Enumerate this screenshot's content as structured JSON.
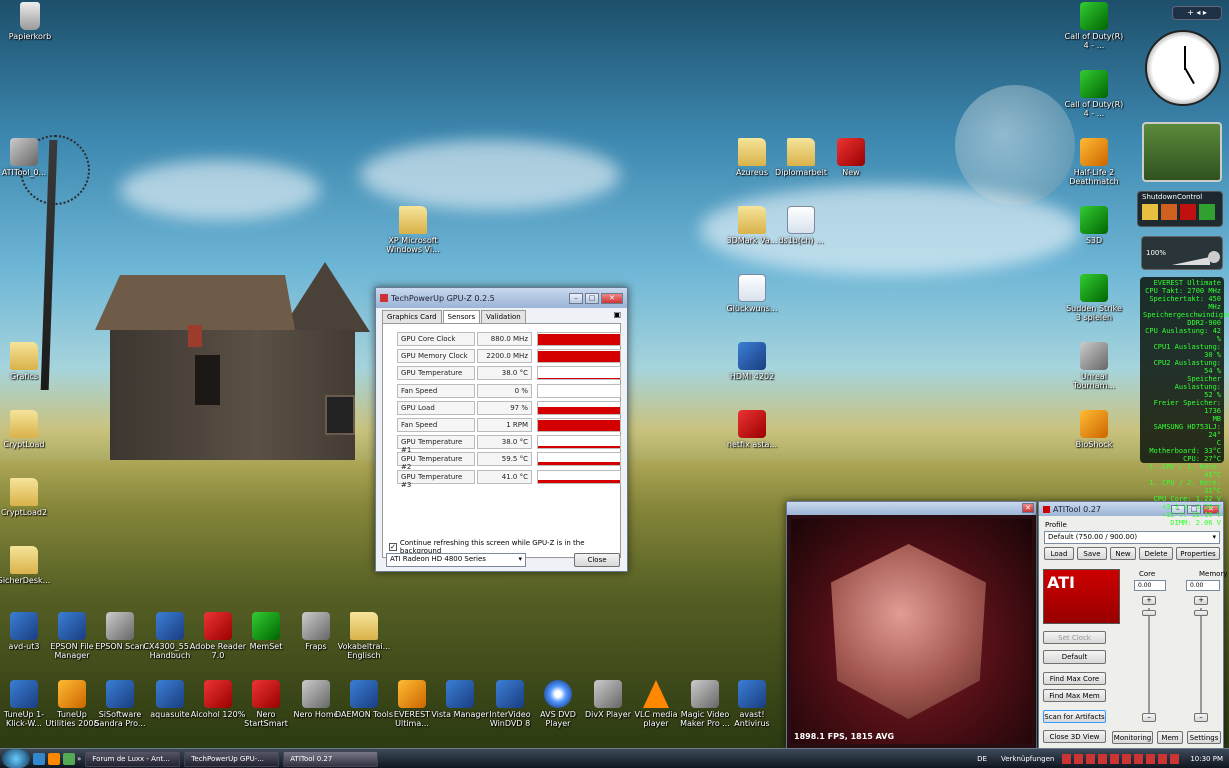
{
  "desktop_icons": [
    {
      "id": "papierkorb",
      "label": "Papierkorb",
      "kind": "bin"
    },
    {
      "id": "atitool",
      "label": "ATITool_0...",
      "kind": "gray"
    },
    {
      "id": "grafics",
      "label": "Grafics",
      "kind": "folder"
    },
    {
      "id": "cryptload",
      "label": "CryptLoad",
      "kind": "folder"
    },
    {
      "id": "cryptload2",
      "label": "CryptLoad2",
      "kind": "folder"
    },
    {
      "id": "sicherdesk",
      "label": "SicherDesk...",
      "kind": "folder"
    },
    {
      "id": "xp_theme",
      "label": "XP Microsoft Windows Vi...",
      "kind": "folder"
    },
    {
      "id": "azureus",
      "label": "Azureus",
      "kind": "folder"
    },
    {
      "id": "diplomarbeit",
      "label": "Diplomarbeit",
      "kind": "folder"
    },
    {
      "id": "new",
      "label": "New",
      "kind": "red"
    },
    {
      "id": "3dmark",
      "label": "3DMark Va...",
      "kind": "folder"
    },
    {
      "id": "ds1b",
      "label": "ds1b(ch) ...",
      "kind": "doc"
    },
    {
      "id": "glueckwunsch",
      "label": "Glückwuns...",
      "kind": "doc"
    },
    {
      "id": "hdmi",
      "label": "HDMI 4202",
      "kind": "exe"
    },
    {
      "id": "netfix",
      "label": "netfix asta...",
      "kind": "red"
    },
    {
      "id": "cod1",
      "label": "Call of Duty(R) 4 - ...",
      "kind": "green"
    },
    {
      "id": "cod2",
      "label": "Call of Duty(R) 4 - ...",
      "kind": "green"
    },
    {
      "id": "halflife",
      "label": "Half-Life 2 Deathmatch",
      "kind": "orange"
    },
    {
      "id": "s3d",
      "label": "S3D",
      "kind": "green"
    },
    {
      "id": "sudden",
      "label": "Sudden Strike 3 spielen",
      "kind": "green"
    },
    {
      "id": "unreal",
      "label": "Unreal Tournam...",
      "kind": "gray"
    },
    {
      "id": "bioshock",
      "label": "BioShock",
      "kind": "orange"
    }
  ],
  "bottom_icons_row1": [
    {
      "id": "avd",
      "label": "avd-ut3",
      "kind": "exe"
    },
    {
      "id": "epson_fm",
      "label": "EPSON File Manager",
      "kind": "exe"
    },
    {
      "id": "epson_scan",
      "label": "EPSON Scan",
      "kind": "gray"
    },
    {
      "id": "cx4300",
      "label": "CX4300_55... Handbuch",
      "kind": "exe"
    },
    {
      "id": "adobe",
      "label": "Adobe Reader 7.0",
      "kind": "red"
    },
    {
      "id": "memset",
      "label": "MemSet",
      "kind": "green"
    },
    {
      "id": "fraps",
      "label": "Fraps",
      "kind": "gray"
    },
    {
      "id": "vokabel",
      "label": "Vokabeltrai... Englisch",
      "kind": "folder"
    }
  ],
  "bottom_icons_row2": [
    {
      "id": "tuneup1",
      "label": "TuneUp 1-Klick-W...",
      "kind": "exe"
    },
    {
      "id": "tuneup2",
      "label": "TuneUp Utilities 2008",
      "kind": "orange"
    },
    {
      "id": "sisoft",
      "label": "SiSoftware Sandra Pro...",
      "kind": "exe"
    },
    {
      "id": "aquasuite",
      "label": "aquasuite",
      "kind": "exe"
    },
    {
      "id": "alcohol",
      "label": "Alcohol 120%",
      "kind": "red"
    },
    {
      "id": "nero_ss",
      "label": "Nero StartSmart",
      "kind": "red"
    },
    {
      "id": "nero_home",
      "label": "Nero Home",
      "kind": "gray"
    },
    {
      "id": "daemon",
      "label": "DAEMON Tools",
      "kind": "exe"
    },
    {
      "id": "everest",
      "label": "EVEREST Ultima...",
      "kind": "orange"
    },
    {
      "id": "vista_mgr",
      "label": "Vista Manager",
      "kind": "exe"
    },
    {
      "id": "intervideo",
      "label": "InterVideo WinDVD 8",
      "kind": "exe"
    },
    {
      "id": "avsdvd",
      "label": "AVS DVD Player",
      "kind": "disc"
    },
    {
      "id": "divx",
      "label": "DivX Player",
      "kind": "gray"
    },
    {
      "id": "vlc",
      "label": "VLC media player",
      "kind": "cone"
    },
    {
      "id": "magicvideo",
      "label": "Magic Video Maker Pro ...",
      "kind": "gray"
    },
    {
      "id": "avast",
      "label": "avast! Antivirus",
      "kind": "exe"
    }
  ],
  "gpuz": {
    "title": "TechPowerUp GPU-Z 0.2.5",
    "tabs": [
      "Graphics Card",
      "Sensors",
      "Validation"
    ],
    "sensors": [
      {
        "label": "GPU Core Clock",
        "value": "880.0 MHz",
        "fill": 0.95
      },
      {
        "label": "GPU Memory Clock",
        "value": "2200.0 MHz",
        "fill": 0.95
      },
      {
        "label": "GPU Temperature",
        "value": "38.0 °C",
        "fill": 0.15
      },
      {
        "label": "Fan Speed",
        "value": "0 %",
        "fill": 0.0
      },
      {
        "label": "GPU Load",
        "value": "97 %",
        "fill": 0.6
      },
      {
        "label": "Fan Speed",
        "value": "1 RPM",
        "fill": 0.95
      },
      {
        "label": "GPU Temperature #1",
        "value": "38.0 °C",
        "fill": 0.15
      },
      {
        "label": "GPU Temperature #2",
        "value": "59.5 °C",
        "fill": 0.3
      },
      {
        "label": "GPU Temperature #3",
        "value": "41.0 °C",
        "fill": 0.18
      }
    ],
    "checkbox_label": "Continue refreshing this screen while GPU-Z is in the background",
    "device": "ATI Radeon HD 4800 Series",
    "close_label": "Close"
  },
  "render_window": {
    "fps": "1898.1 FPS, 1815 AVG"
  },
  "atitool": {
    "title": "ATITool 0.27",
    "profile_label": "Profile",
    "profile_value": "Default (750.00 / 900.00)",
    "buttons": {
      "load": "Load",
      "save": "Save",
      "new": "New",
      "delete": "Delete",
      "properties": "Properties"
    },
    "core_label": "Core",
    "memory_label": "Memory",
    "core_value": "0.00",
    "memory_value": "0.00",
    "set_clock": "Set Clock",
    "default": "Default",
    "find_max_core": "Find Max Core",
    "find_max_mem": "Find Max Mem",
    "scan_artifacts": "Scan for Artifacts",
    "close_3d": "Close 3D View",
    "monitoring": "Monitoring",
    "mem": "Mem",
    "settings": "Settings"
  },
  "gadgets": {
    "shutdown_title": "ShutdownControl",
    "volume": "100%",
    "everest_lines": [
      "EVEREST Ultimate",
      "CPU Takt: 2700 MHz",
      "Speichertakt: 450 MHz",
      "Speichergeschwindigkeit",
      "DDR2-900",
      "CPU Auslastung: 42 %",
      "CPU1 Auslastung: 30 %",
      "CPU2 Auslastung: 54 %",
      "Speicher Auslastung:",
      "52 %",
      "Freier Speicher: 1736",
      "MB",
      "SAMSUNG HD753LJ: 24°",
      "C",
      "Motherboard: 33°C",
      "CPU: 27°C",
      "1. CPU / 1. Kern: 41°C",
      "1. CPU / 2. Kern: 31°C",
      "CPU Core: 1.22 V",
      "+3.3 V: 3.20 V",
      "+12 V: 12.19 V",
      "DIMM: 2.06 V"
    ]
  },
  "taskbar": {
    "items": [
      "Forum de Luxx - Ant...",
      "TechPowerUp GPU-...",
      "ATITool 0.27"
    ],
    "lang": "DE",
    "links": "Verknüpfungen",
    "time": "10:30 PM"
  }
}
